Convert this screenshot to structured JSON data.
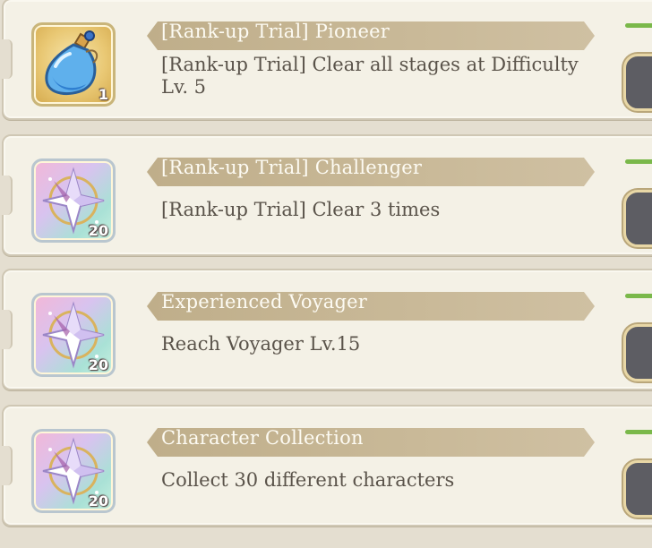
{
  "missions": [
    {
      "title": "[Rank-up Trial] Pioneer",
      "description": "[Rank-up Trial] Clear all stages at Difficulty Lv. 5",
      "reward_icon": "potion-icon",
      "reward_count": "1"
    },
    {
      "title": "[Rank-up Trial] Challenger",
      "description": "[Rank-up Trial] Clear 3 times",
      "reward_icon": "crystal-icon",
      "reward_count": "20"
    },
    {
      "title": "Experienced Voyager",
      "description": "Reach Voyager Lv.15",
      "reward_icon": "crystal-icon",
      "reward_count": "20"
    },
    {
      "title": "Character Collection",
      "description": "Collect 30 different characters",
      "reward_icon": "crystal-icon",
      "reward_count": "20"
    }
  ],
  "colors": {
    "ribbon": "#c4b392",
    "progress": "#7ab84a",
    "button": "#5d5d63"
  }
}
